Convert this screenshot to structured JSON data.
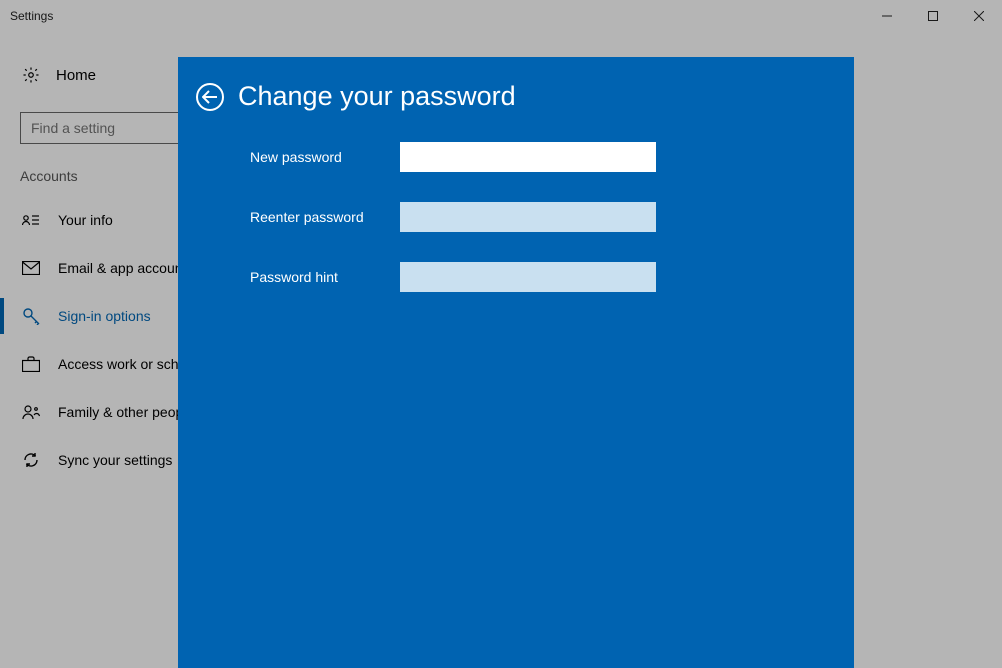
{
  "window": {
    "title": "Settings"
  },
  "sidebar": {
    "home_label": "Home",
    "search_placeholder": "Find a setting",
    "section_label": "Accounts",
    "items": [
      {
        "label": "Your info"
      },
      {
        "label": "Email & app accounts"
      },
      {
        "label": "Sign-in options"
      },
      {
        "label": "Access work or school"
      },
      {
        "label": "Family & other people"
      },
      {
        "label": "Sync your settings"
      }
    ]
  },
  "modal": {
    "title": "Change your password",
    "fields": {
      "new_password_label": "New password",
      "reenter_label": "Reenter password",
      "hint_label": "Password hint",
      "new_password_value": "",
      "reenter_value": "",
      "hint_value": ""
    }
  }
}
